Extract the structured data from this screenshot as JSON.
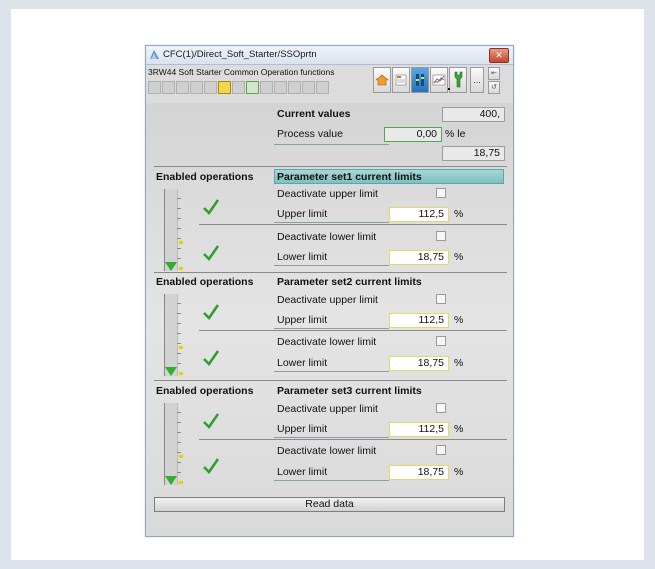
{
  "window": {
    "title": "CFC(1)/Direct_Soft_Starter/SSOprtn",
    "close_glyph": "✕"
  },
  "toolbar": {
    "title": "3RW44 Soft Starter Common Operation functions",
    "small_btn_1": "⇤",
    "small_btn_2": "↺",
    "more_btn": "..."
  },
  "current": {
    "header": "Current values",
    "value": "400,",
    "process_label": "Process value",
    "process_value": "0,00",
    "process_unit": "% le",
    "extra_value": "18,75"
  },
  "sections": [
    {
      "enabled_label": "Enabled operations",
      "title": "Parameter set1 current limits",
      "deactivate_upper": "Deactivate upper limit",
      "upper_label": "Upper limit",
      "upper_value": "112,5",
      "deactivate_lower": "Deactivate lower limit",
      "lower_label": "Lower limit",
      "lower_value": "18,75",
      "unit": "%"
    },
    {
      "enabled_label": "Enabled operations",
      "title": "Parameter set2 current limits",
      "deactivate_upper": "Deactivate upper limit",
      "upper_label": "Upper limit",
      "upper_value": "112,5",
      "deactivate_lower": "Deactivate lower limit",
      "lower_label": "Lower limit",
      "lower_value": "18,75",
      "unit": "%"
    },
    {
      "enabled_label": "Enabled operations",
      "title": "Parameter set3 current limits",
      "deactivate_upper": "Deactivate upper limit",
      "upper_label": "Upper limit",
      "upper_value": "112,5",
      "deactivate_lower": "Deactivate lower limit",
      "lower_label": "Lower limit",
      "lower_value": "18,75",
      "unit": "%"
    }
  ],
  "read_button": "Read data",
  "colors": {
    "checkmark": "#2e9e2e",
    "teal_header": "#8fcaca",
    "close": "#c6452c"
  }
}
